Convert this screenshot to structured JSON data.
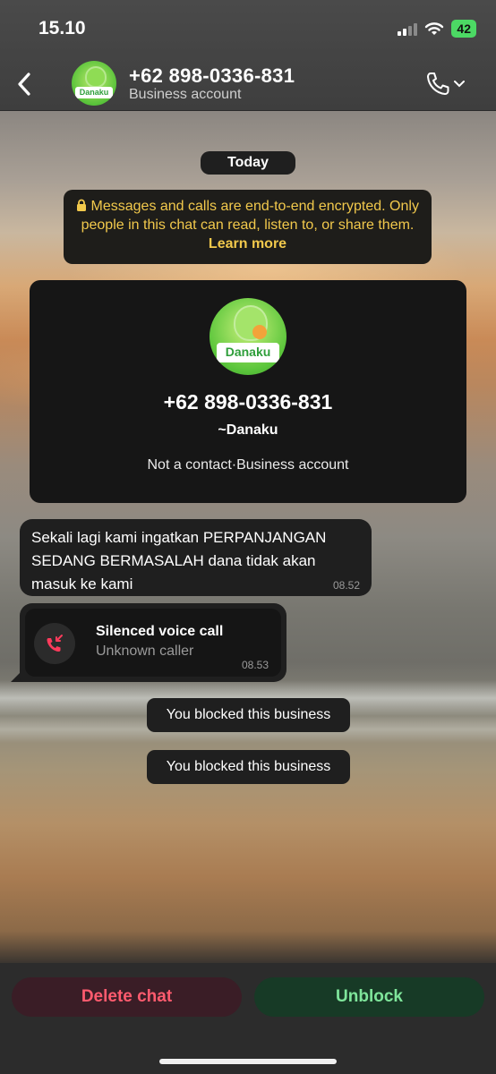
{
  "status_bar": {
    "time": "15.10",
    "battery": "42"
  },
  "header": {
    "title": "+62 898-0336-831",
    "subtitle": "Business account",
    "avatar_text": "Danaku"
  },
  "chat": {
    "date_label": "Today",
    "encryption_notice": {
      "text": "Messages and calls are end-to-end encrypted. Only people in this chat can read, listen to, or share them.",
      "link": "Learn more"
    },
    "profile_card": {
      "avatar_text": "Danaku",
      "phone": "+62 898-0336-831",
      "alias": "~Danaku",
      "info": "Not a contact·Business account"
    },
    "messages": [
      {
        "text": "Sekali lagi kami ingatkan PERPANJANGAN SEDANG BERMASALAH dana tidak akan masuk ke kami",
        "time": "08.52"
      }
    ],
    "call": {
      "title": "Silenced voice call",
      "subtitle": "Unknown caller",
      "time": "08.53"
    },
    "system_notices": [
      "You blocked this business",
      "You blocked this business"
    ]
  },
  "actions": {
    "delete_label": "Delete chat",
    "unblock_label": "Unblock"
  },
  "icons": {
    "back": "chevron-left-icon",
    "call": "phone-icon",
    "lock": "lock-icon",
    "missed_call": "missed-call-icon"
  },
  "colors": {
    "encryption_text": "#f2c94c",
    "delete": "#ff5b6e",
    "unblock": "#7fe59b",
    "missed_call": "#ff3b5c"
  }
}
